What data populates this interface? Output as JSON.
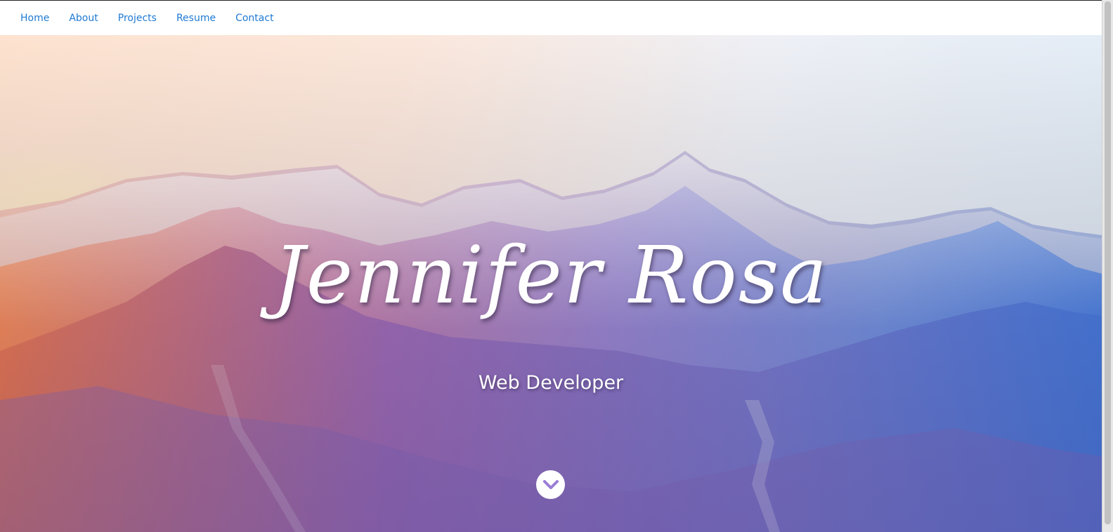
{
  "nav": {
    "items": [
      {
        "label": "Home"
      },
      {
        "label": "About"
      },
      {
        "label": "Projects"
      },
      {
        "label": "Resume"
      },
      {
        "label": "Contact"
      }
    ]
  },
  "hero": {
    "title": "Jennifer Rosa",
    "subtitle": "Web Developer",
    "scroll_icon": "chevron-down-icon"
  },
  "colors": {
    "nav_link": "#1f7ad3",
    "gradient_left": "#ff7a45",
    "gradient_mid": "#a07ad8",
    "gradient_right": "#3a78e8"
  }
}
